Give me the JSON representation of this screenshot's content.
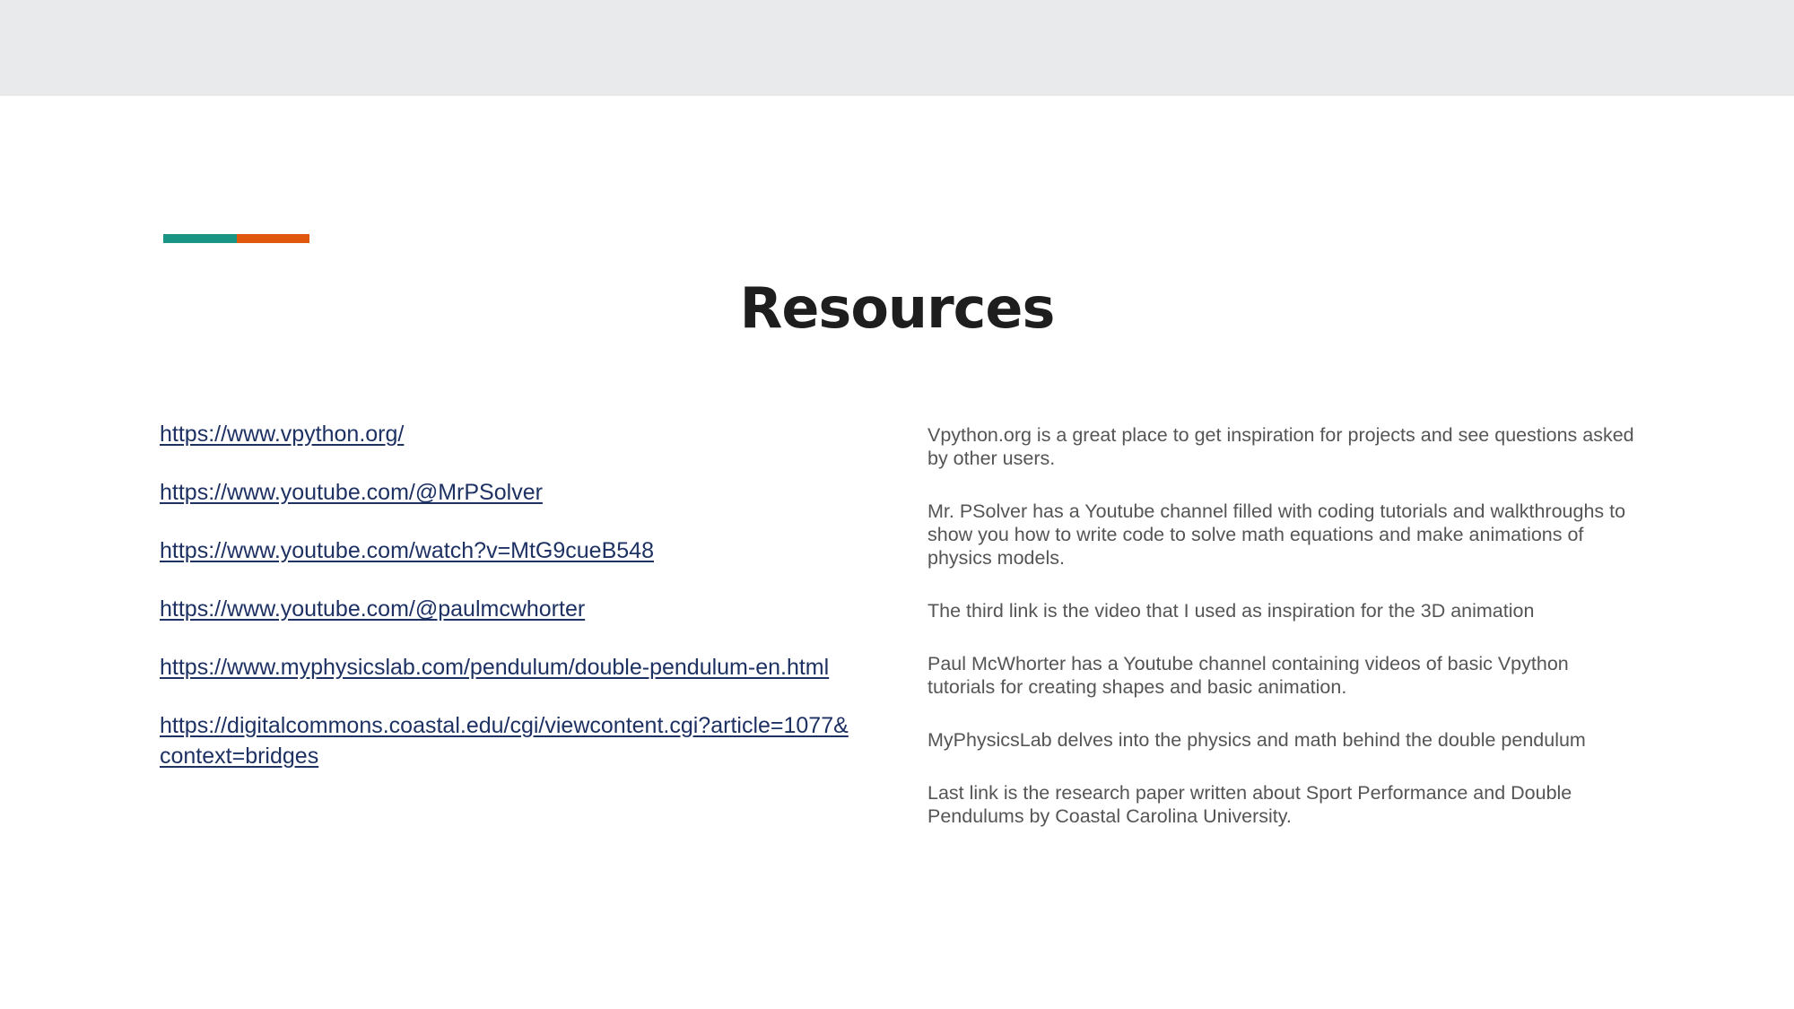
{
  "slide": {
    "title": "Resources",
    "accent_colors": [
      "#1a9585",
      "#e0580e"
    ],
    "link_color": "#1d3163",
    "band_color": "#e8eaeb",
    "links": [
      "https://www.vpython.org/",
      "https://www.youtube.com/@MrPSolver",
      "https://www.youtube.com/watch?v=MtG9cueB548",
      "https://www.youtube.com/@paulmcwhorter",
      "https://www.myphysicslab.com/pendulum/double-pendulum-en.html",
      "https://digitalcommons.coastal.edu/cgi/viewcontent.cgi?article=1077&context=bridges"
    ],
    "descriptions": [
      "Vpython.org is a great place to get inspiration for projects and see questions asked by other users.",
      "Mr. PSolver has a Youtube channel filled with coding tutorials and walkthroughs to show you how to write code to solve math equations and make animations of physics models.",
      "The third link is the video that I used as inspiration for the 3D animation",
      "Paul McWhorter has a Youtube channel containing videos of basic Vpython tutorials for creating shapes and basic animation.",
      "MyPhysicsLab delves into the physics and math behind the double pendulum",
      "Last link is the research paper written about Sport Performance and Double Pendulums by Coastal Carolina University."
    ]
  }
}
